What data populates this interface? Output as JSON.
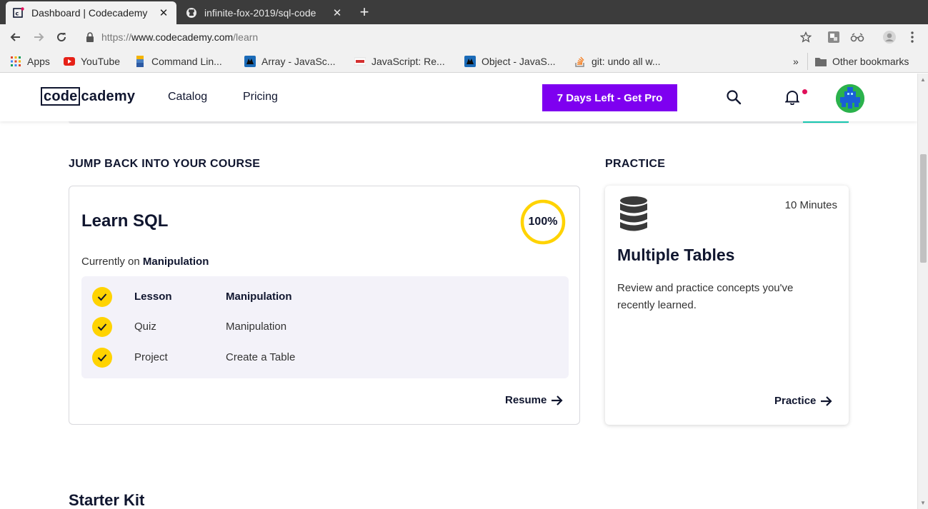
{
  "browser": {
    "tabs": [
      {
        "title": "Dashboard | Codecademy",
        "active": true
      },
      {
        "title": "infinite-fox-2019/sql-code",
        "active": false
      }
    ],
    "url": {
      "prefix": "https://",
      "host": "www.codecademy.com",
      "path": "/learn"
    },
    "bookmarks": [
      {
        "label": "Apps",
        "icon": "apps-grid-icon"
      },
      {
        "label": "YouTube",
        "icon": "youtube-icon"
      },
      {
        "label": "Command Lin...",
        "icon": "command-line-icon"
      },
      {
        "label": "Array - JavaSc...",
        "icon": "mdn-icon"
      },
      {
        "label": "JavaScript: Re...",
        "icon": "javascript-site-icon"
      },
      {
        "label": "Object - JavaS...",
        "icon": "mdn-icon"
      },
      {
        "label": "git: undo all w...",
        "icon": "stackoverflow-icon"
      }
    ],
    "overflow_label": "»",
    "other_bookmarks": "Other bookmarks"
  },
  "header": {
    "logo_box": "code",
    "logo_rest": "cademy",
    "nav": [
      "Catalog",
      "Pricing"
    ],
    "cta": "7 Days Left - Get Pro",
    "brand_color": "#7e00f0"
  },
  "course_section": {
    "label": "JUMP BACK INTO YOUR COURSE",
    "course": {
      "title": "Learn SQL",
      "progress_text": "100%",
      "progress": 1.0,
      "currently_prefix": "Currently on",
      "currently_on": "Manipulation",
      "items": [
        {
          "type": "Lesson",
          "name": "Manipulation",
          "current": true
        },
        {
          "type": "Quiz",
          "name": "Manipulation",
          "current": false
        },
        {
          "type": "Project",
          "name": "Create a Table",
          "current": false
        }
      ],
      "resume_label": "Resume"
    }
  },
  "practice_section": {
    "label": "PRACTICE",
    "card": {
      "duration": "10 Minutes",
      "title": "Multiple Tables",
      "description": "Review and practice concepts you've recently learned.",
      "link_label": "Practice"
    }
  },
  "starter_kit": {
    "title": "Starter Kit"
  }
}
